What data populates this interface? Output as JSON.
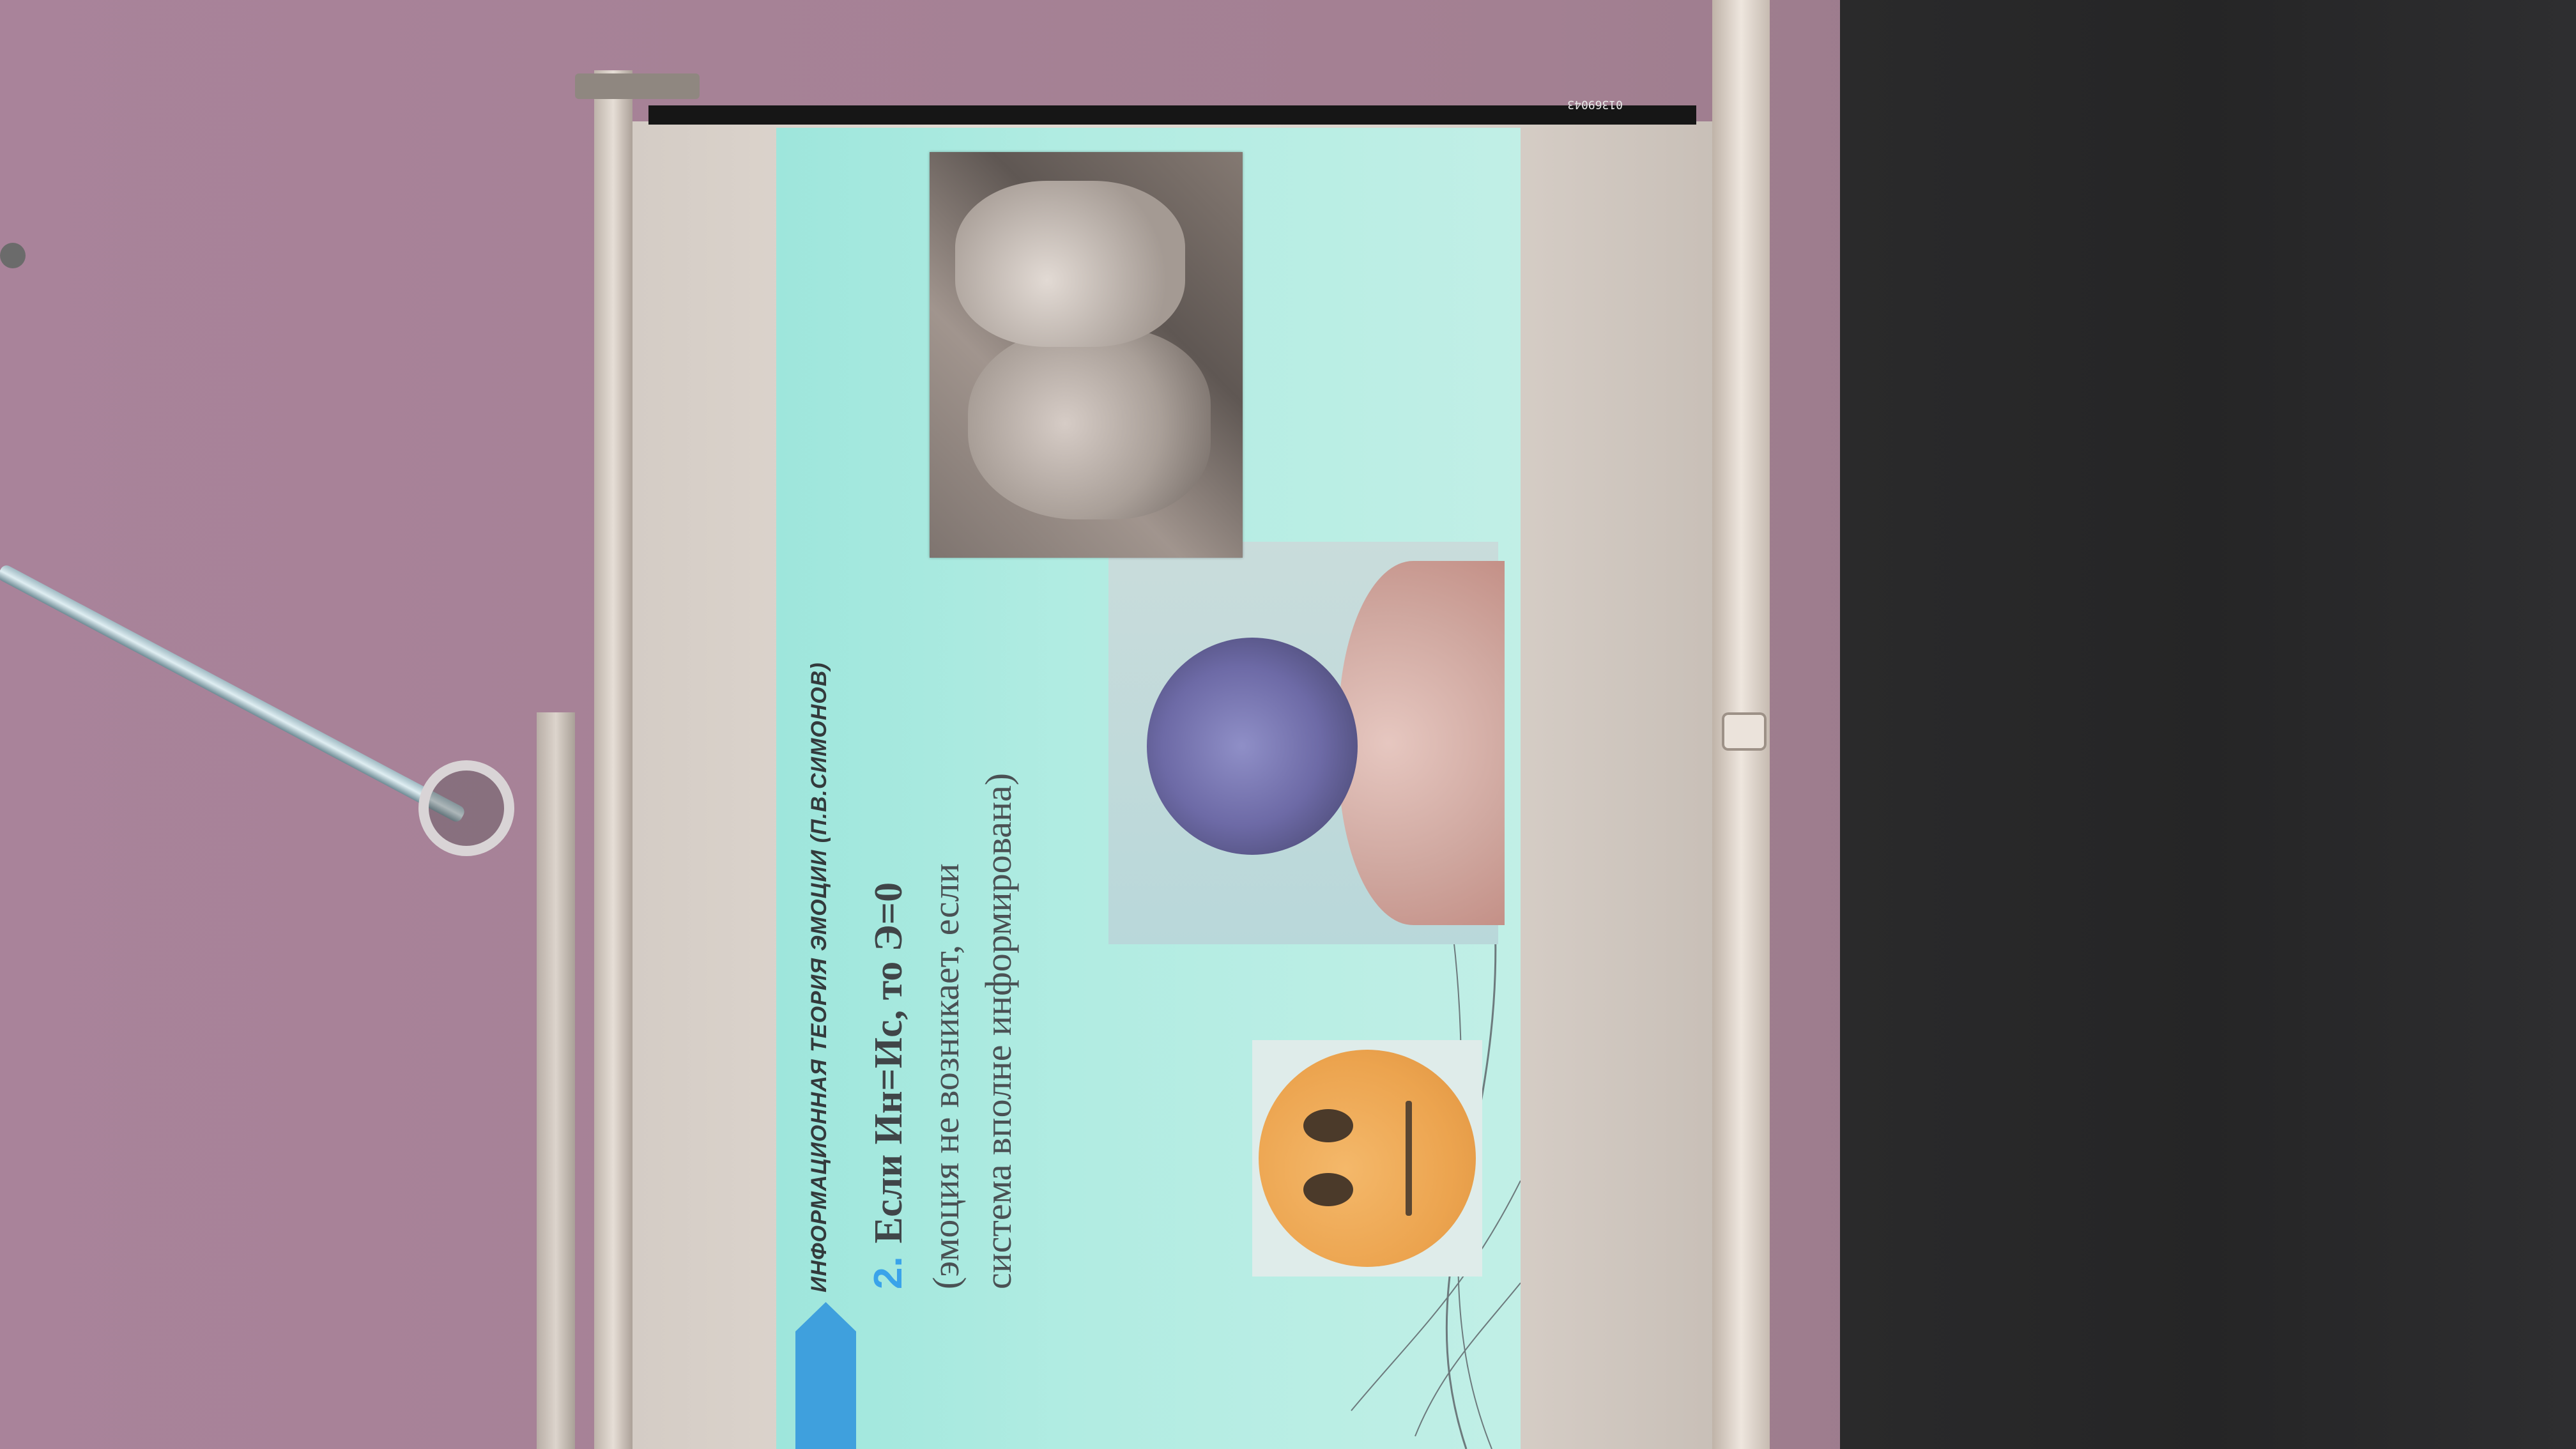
{
  "slide": {
    "title": "ИНФОРМАЦИОННАЯ ТЕОРИЯ ЭМОЦИИ (П.В.СИМОНОВ)",
    "point_number": "2.",
    "point_text": "Если Ин=Ис, то Э=0",
    "point_note": "(эмоция не возникает, если система вполне информирована)"
  },
  "screen": {
    "serial_label": "0136904З"
  },
  "icons": {
    "emoji": "neutral-face-icon"
  },
  "colors": {
    "slide_bg": "#b1ece2",
    "accent_blue": "#3fa0dd",
    "emoji_orange": "#eca44f",
    "wall": "#a27e8f"
  }
}
